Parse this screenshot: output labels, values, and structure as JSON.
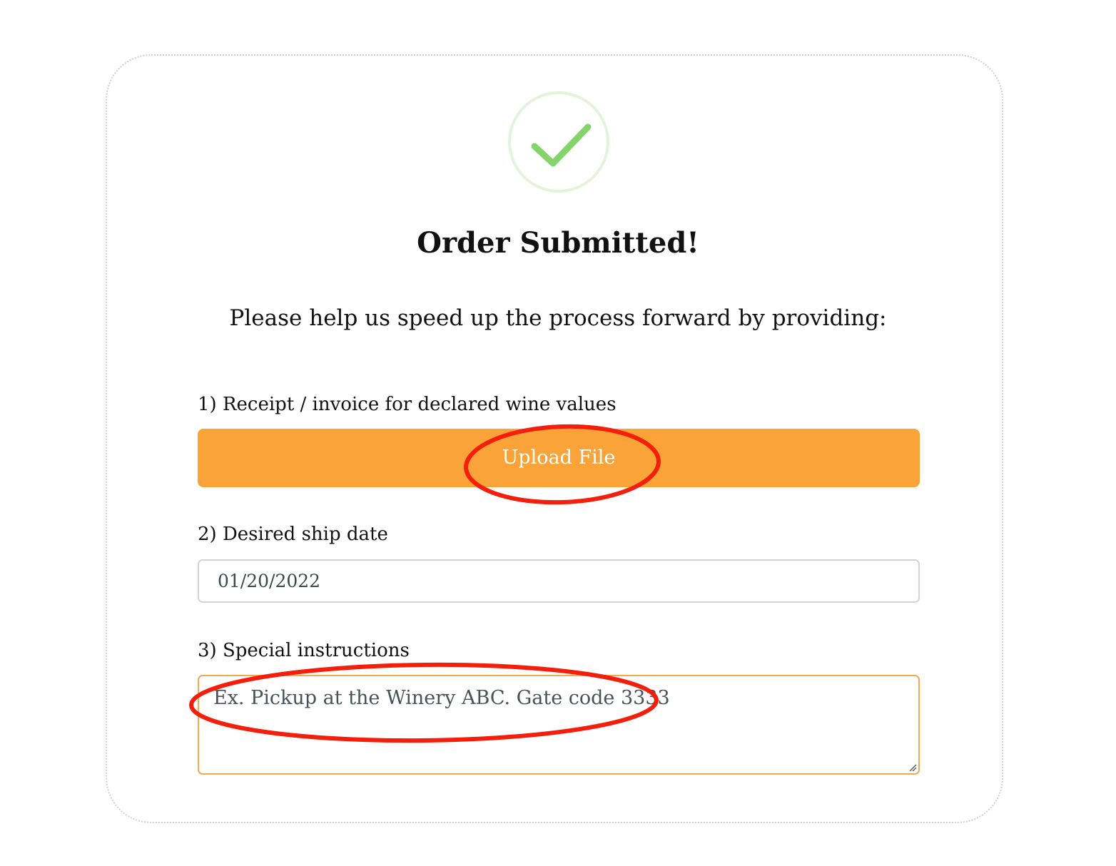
{
  "title": "Order Submitted!",
  "subtitle": "Please help us speed up the process forward by providing:",
  "success_icon": "check-icon",
  "colors": {
    "accent_orange": "#f9a338",
    "check_green": "#85d36b",
    "annotation_red": "#f31e0b"
  },
  "fields": {
    "receipt": {
      "label": "1) Receipt / invoice for declared wine values",
      "button_label": "Upload File"
    },
    "ship_date": {
      "label": "2) Desired ship date",
      "value": "01/20/2022"
    },
    "instructions": {
      "label": "3) Special instructions",
      "placeholder": "Ex. Pickup at the Winery ABC. Gate code 3333"
    }
  }
}
